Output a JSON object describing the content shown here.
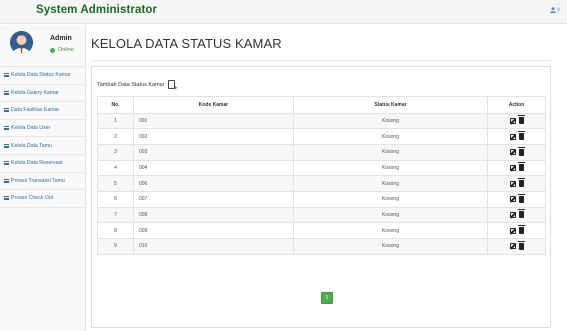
{
  "header": {
    "brand": "System Administrator",
    "user_menu_icon": "user-icon",
    "user_menu_caret": "v"
  },
  "sidebar": {
    "profile": {
      "name": "Admin",
      "status": "Online",
      "avatar_icon": "avatar-icon"
    },
    "items": [
      {
        "label": "Kelola Data Status Kamar",
        "icon": "table-icon"
      },
      {
        "label": "Kelola Galery Kamar",
        "icon": "table-icon"
      },
      {
        "label": "Data Fasilitas Kamar",
        "icon": "table-icon"
      },
      {
        "label": "Kelola Data User",
        "icon": "table-icon"
      },
      {
        "label": "Kelola Data Tamu",
        "icon": "table-icon"
      },
      {
        "label": "Kelola Data Reservasi",
        "icon": "table-icon"
      },
      {
        "label": "Proses Transaksi Tamu",
        "icon": "table-icon"
      },
      {
        "label": "Proses Check Out",
        "icon": "table-icon"
      }
    ]
  },
  "main": {
    "title": "KELOLA DATA STATUS KAMAR",
    "add_label": "Tambah Data Status Kamar",
    "table": {
      "columns": [
        "No.",
        "Kode Kamar",
        "Status Kamar",
        "Action"
      ],
      "rows": [
        {
          "no": "1",
          "kode": "001",
          "status": "Kosong"
        },
        {
          "no": "2",
          "kode": "002",
          "status": "Kosong"
        },
        {
          "no": "3",
          "kode": "003",
          "status": "Kosong"
        },
        {
          "no": "4",
          "kode": "004",
          "status": "Kosong"
        },
        {
          "no": "5",
          "kode": "006",
          "status": "Kosong"
        },
        {
          "no": "6",
          "kode": "007",
          "status": "Kosong"
        },
        {
          "no": "7",
          "kode": "008",
          "status": "Kosong"
        },
        {
          "no": "8",
          "kode": "009",
          "status": "Kosong"
        },
        {
          "no": "9",
          "kode": "010",
          "status": "Kosong"
        }
      ]
    },
    "pagination": {
      "current_page": "1"
    }
  },
  "colors": {
    "brand": "#1d6b23",
    "link": "#2c6fb0",
    "online": "#4cae4c",
    "pager": "#4cae4c"
  }
}
